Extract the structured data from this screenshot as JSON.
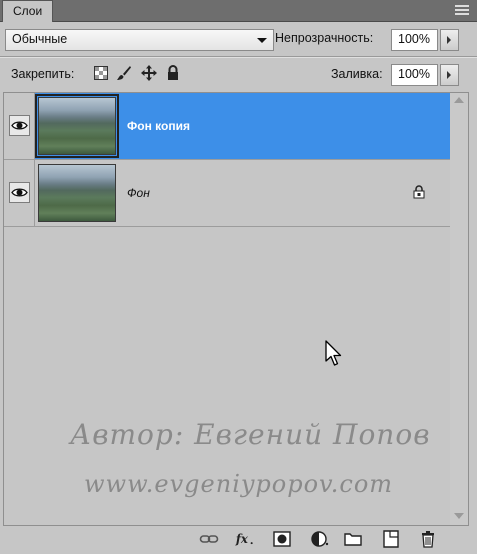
{
  "panel": {
    "tab_label": "Слои"
  },
  "blend": {
    "mode": "Обычные"
  },
  "opacity": {
    "label": "Непрозрачность:",
    "value": "100%"
  },
  "lock": {
    "label": "Закрепить:"
  },
  "fill": {
    "label": "Заливка:",
    "value": "100%"
  },
  "layers": [
    {
      "name": "Фон копия",
      "selected": true,
      "locked": false
    },
    {
      "name": "Фон",
      "selected": false,
      "locked": true
    }
  ],
  "watermark": {
    "line1": "Автор: Евгений Попов",
    "line2": "www.evgeniypopov.com"
  },
  "colors": {
    "selection": "#3d8fe8",
    "panel": "#c6c6c6"
  }
}
